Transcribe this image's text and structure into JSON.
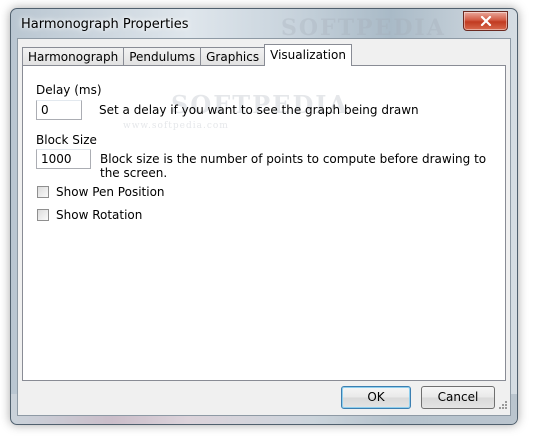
{
  "window": {
    "title": "Harmonograph Properties"
  },
  "tabs": [
    {
      "label": "Harmonograph"
    },
    {
      "label": "Pendulums"
    },
    {
      "label": "Graphics"
    },
    {
      "label": "Visualization",
      "active": true
    }
  ],
  "visualization": {
    "delay": {
      "label": "Delay (ms)",
      "value": "0",
      "hint": "Set a delay if you want to see the graph being drawn"
    },
    "block_size": {
      "label": "Block Size",
      "value": "1000",
      "hint": "Block size is the number of points to compute before drawing to the screen."
    },
    "show_pen_position": {
      "label": "Show Pen Position",
      "checked": false
    },
    "show_rotation": {
      "label": "Show Rotation",
      "checked": false
    }
  },
  "buttons": {
    "ok": "OK",
    "cancel": "Cancel"
  },
  "watermark": {
    "text": "SOFTPEDIA",
    "url": "www.softpedia.com"
  },
  "icons": {
    "close": "close-icon",
    "resize": "resize-grip-icon"
  },
  "colors": {
    "close_button": "#c8442a",
    "default_button_border": "#3c7fb1"
  }
}
